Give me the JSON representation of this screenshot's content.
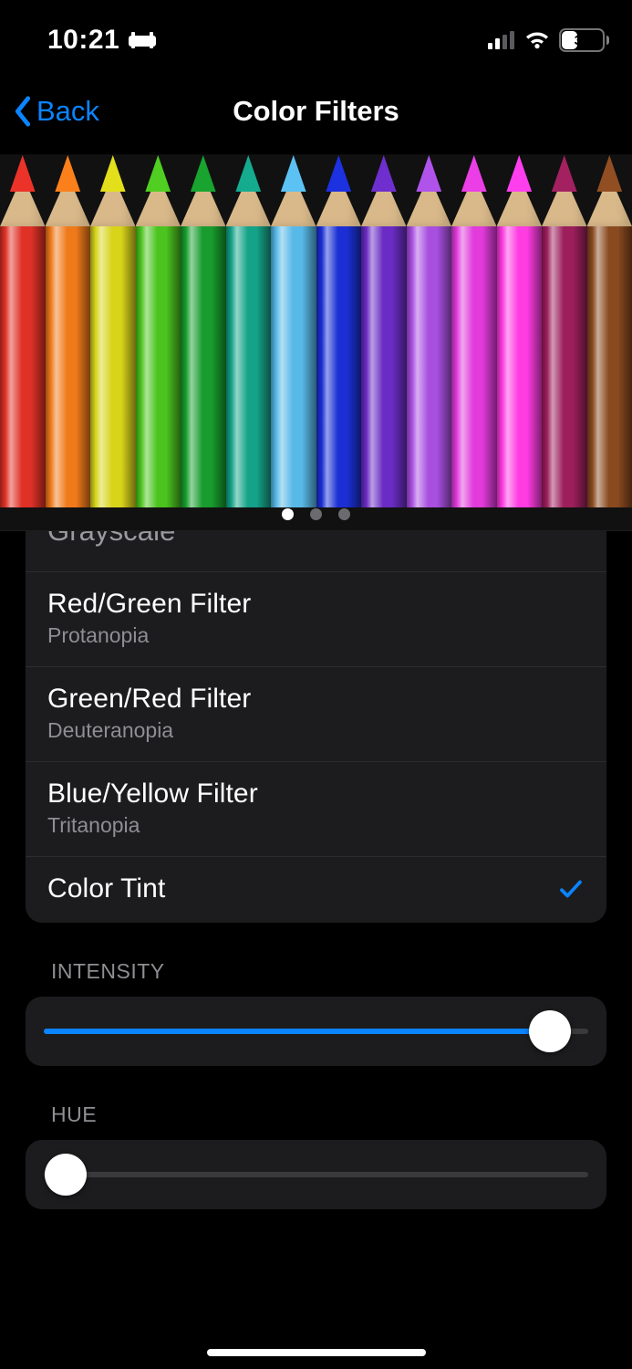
{
  "status": {
    "time": "10:21",
    "battery_pct": "38",
    "battery_level": 0.38
  },
  "nav": {
    "back_label": "Back",
    "title": "Color Filters"
  },
  "preview": {
    "pencil_colors": [
      "#e03127",
      "#ef7a1a",
      "#d8d41a",
      "#4cc41f",
      "#179c2d",
      "#14a388",
      "#58b9e8",
      "#1b2fd4",
      "#6a2cc4",
      "#a84fe0",
      "#e13bdc",
      "#ff3be2",
      "#9c1f5c",
      "#8a4a20"
    ],
    "active_dot": 0,
    "dot_count": 3
  },
  "options": [
    {
      "title": "Grayscale",
      "sub": "",
      "selected": false,
      "partial": true
    },
    {
      "title": "Red/Green Filter",
      "sub": "Protanopia",
      "selected": false
    },
    {
      "title": "Green/Red Filter",
      "sub": "Deuteranopia",
      "selected": false
    },
    {
      "title": "Blue/Yellow Filter",
      "sub": "Tritanopia",
      "selected": false
    },
    {
      "title": "Color Tint",
      "sub": "",
      "selected": true
    }
  ],
  "sliders": {
    "intensity": {
      "header": "INTENSITY",
      "value": 0.93
    },
    "hue": {
      "header": "HUE",
      "value": 0.04
    }
  }
}
